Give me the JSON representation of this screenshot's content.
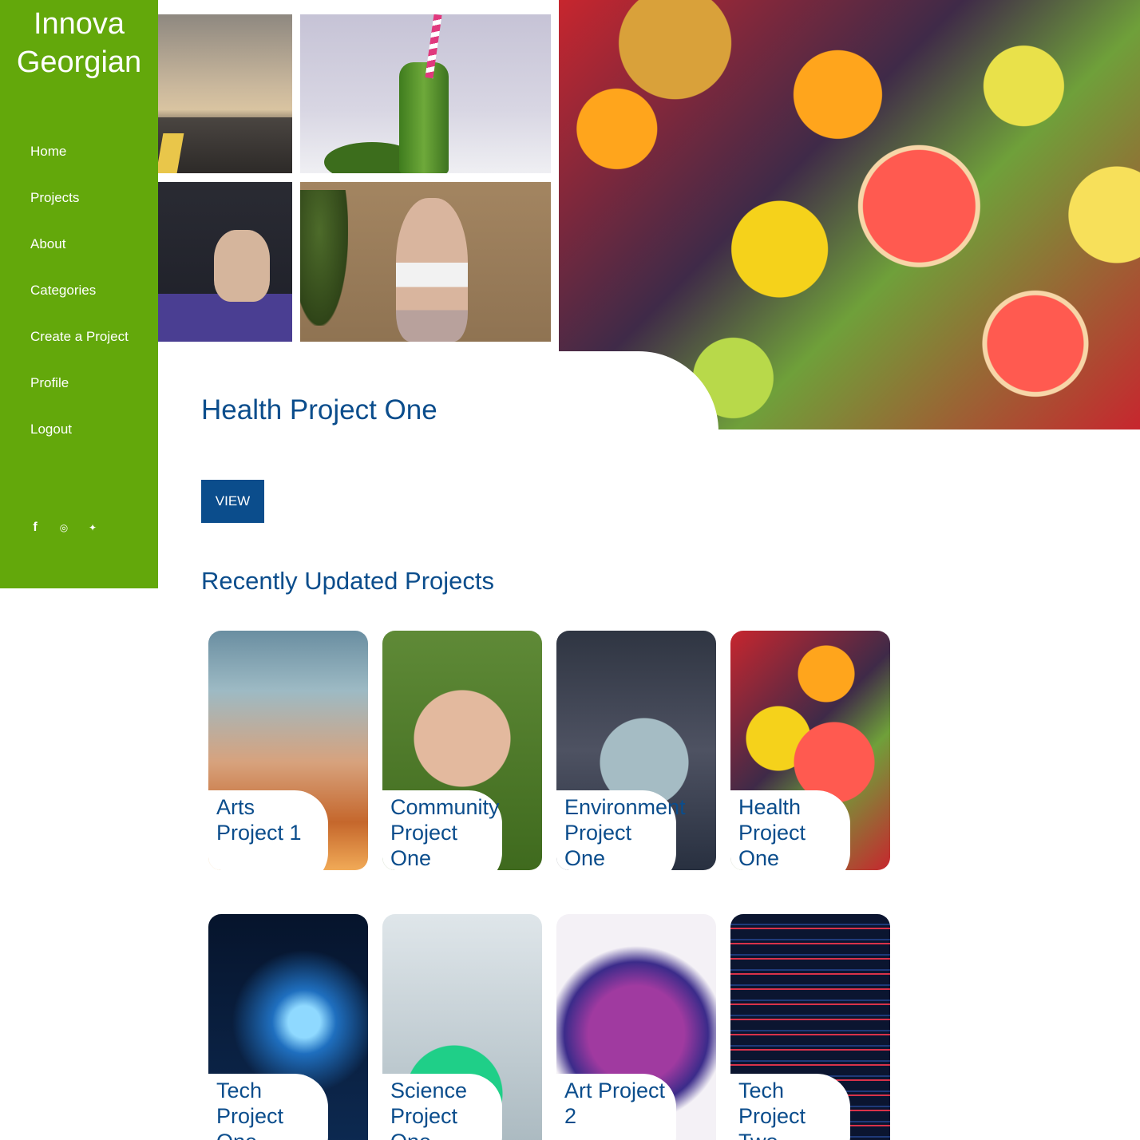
{
  "brand": "Innova Georgian",
  "nav": {
    "items": [
      {
        "label": "Home"
      },
      {
        "label": "Projects"
      },
      {
        "label": "About"
      },
      {
        "label": "Categories"
      },
      {
        "label": "Create a Project"
      },
      {
        "label": "Profile"
      },
      {
        "label": "Logout"
      }
    ]
  },
  "social": {
    "facebook": "f",
    "instagram": "◎",
    "twitter": "✦"
  },
  "hero": {
    "title": "Health Project One",
    "view_label": "VIEW"
  },
  "recent": {
    "title": "Recently Updated Projects",
    "cards": [
      {
        "label": "Arts\nProject 1"
      },
      {
        "label": "Community\nProject\nOne"
      },
      {
        "label": "Environment\nProject\nOne"
      },
      {
        "label": "Health\nProject\nOne"
      },
      {
        "label": "Tech\nProject\nOne"
      },
      {
        "label": "Science\nProject\nOne"
      },
      {
        "label": "Art Project\n2"
      },
      {
        "label": "Tech\nProject\nTwo"
      }
    ]
  },
  "colors": {
    "sidebar": "#63a80b",
    "primary": "#0b4d8c"
  }
}
